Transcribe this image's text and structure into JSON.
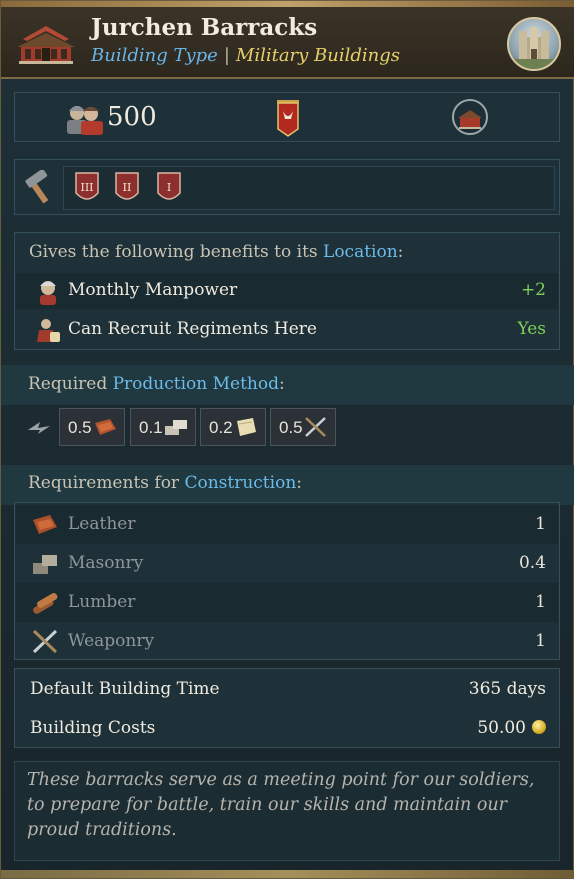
{
  "header": {
    "title": "Jurchen Barracks",
    "type_key": "Building Type",
    "separator": "|",
    "type_value": "Military Buildings"
  },
  "stats": {
    "manpower_value": "500"
  },
  "benefits": {
    "intro_prefix": "Gives the following benefits to its ",
    "intro_link": "Location",
    "intro_suffix": ":",
    "rows": [
      {
        "label": "Monthly Manpower",
        "value": "+2"
      },
      {
        "label": "Can Recruit Regiments Here",
        "value": "Yes"
      }
    ]
  },
  "tool_row": {
    "shields": [
      "III",
      "II",
      "I"
    ]
  },
  "production": {
    "prefix": "Required ",
    "link": "Production Method",
    "suffix": ":",
    "inputs": [
      {
        "amount": "0.5",
        "icon": "leather-icon"
      },
      {
        "amount": "0.1",
        "icon": "masonry-icon"
      },
      {
        "amount": "0.2",
        "icon": "paper-icon"
      },
      {
        "amount": "0.5",
        "icon": "weaponry-icon"
      }
    ]
  },
  "construction": {
    "prefix": "Requirements for ",
    "link": "Construction",
    "suffix": ":",
    "rows": [
      {
        "label": "Leather",
        "value": "1"
      },
      {
        "label": "Masonry",
        "value": "0.4"
      },
      {
        "label": "Lumber",
        "value": "1"
      },
      {
        "label": "Weaponry",
        "value": "1"
      }
    ]
  },
  "timing": {
    "time_label": "Default Building Time",
    "time_value": "365 days",
    "cost_label": "Building Costs",
    "cost_value": "50.00"
  },
  "flavor": "These barracks serve as a meeting point for our soldiers, to prepare for battle, train our skills and maintain our proud traditions.",
  "colors": {
    "link": "#6cbbe8",
    "positive": "#7ecf5a",
    "subtitle_value": "#e7cf6a"
  }
}
